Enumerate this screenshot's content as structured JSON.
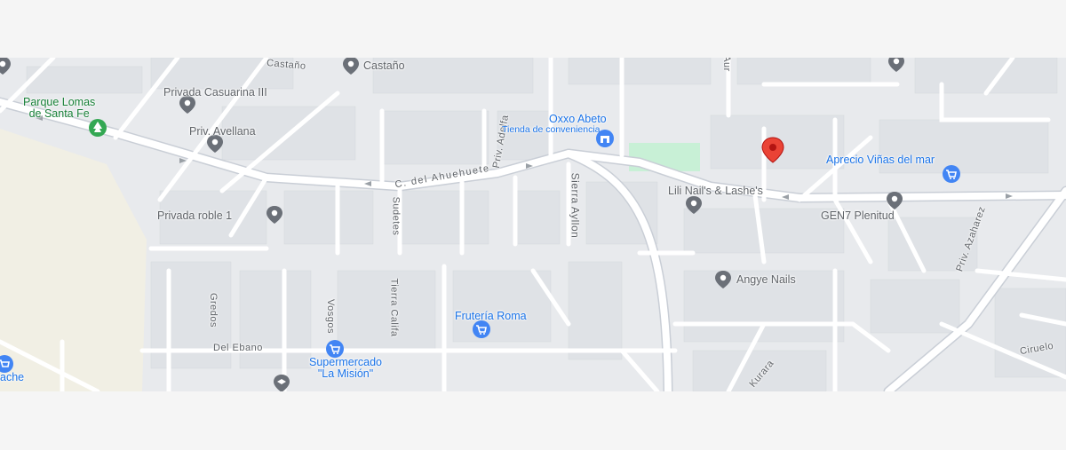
{
  "map": {
    "colors": {
      "background": "#e8eaed",
      "road": "#ffffff",
      "road_edge": "#c9ced6",
      "park": "#c8f0d6",
      "sand": "#f1efe4",
      "place_blue": "#1a73e8",
      "place_gray": "#5f6368",
      "park_green": "#188038",
      "marker_red": "#ea4335"
    },
    "places": {
      "parque": "Parque Lomas\nde Santa Fe",
      "privada_casuarina": "Privada Casuarina III",
      "castano": "Castaño",
      "castano_street": "Castaño",
      "priv_avellana": "Priv. Avellana",
      "oxxo_name": "Oxxo Abeto",
      "oxxo_type": "Tienda de conveniencia",
      "aprecio": "Aprecio Viñas del mar",
      "lili": "Lili Nail's & Lashe's",
      "gen7": "GEN7 Plenitud",
      "privada_roble": "Privada roble 1",
      "angye": "Angye Nails",
      "fruteria": "Frutería Roma",
      "supermercado": "Supermercado\n\"La Misión\"",
      "ache": "ache"
    },
    "streets": {
      "ahuehuete": "C. del Ahuehuete",
      "sierra_ayllon": "Sierra Ayllon",
      "sudetes": "Sudetes",
      "priv_adelfa": "Priv. Adelfa",
      "gredos": "Gredos",
      "vosgos": "Vosgos",
      "tierra_califa": "Tierra Califa",
      "del_ebano": "Del Ebano",
      "priv_azaharez": "Priv. Azaharez",
      "kurara": "Kurara",
      "ciruelo": "Ciruelo",
      "aur": "Aur"
    },
    "icons": {
      "pin_gray": "map-pin-icon",
      "pin_red": "selected-location-pin-icon",
      "tree": "park-tree-icon",
      "shop": "shopping-cart-icon",
      "store": "store-icon",
      "school": "school-icon"
    }
  }
}
